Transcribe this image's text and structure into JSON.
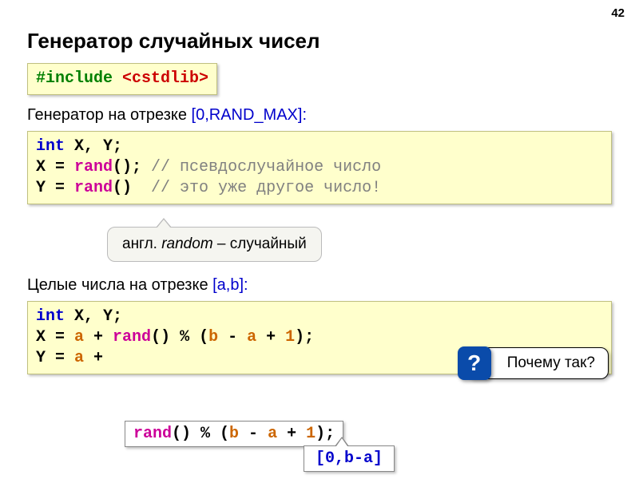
{
  "pageNumber": "42",
  "title": "Генератор случайных чисел",
  "includeLine": {
    "directive": "#include",
    "header": "<cstdlib>"
  },
  "section1": {
    "heading_pre": "Генератор на отрезке ",
    "heading_range": "[0,RAND_MAX]:",
    "code": {
      "l1a": "int",
      "l1b": " X, Y;",
      "l2a": "X = ",
      "l2b": "rand",
      "l2c": "(); ",
      "l2d": "// псевдослучайное число",
      "l3a": "Y = ",
      "l3b": "rand",
      "l3c": "()  ",
      "l3d": "// это уже другое число!"
    }
  },
  "callout": {
    "text_pre": "англ. ",
    "text_em": "random",
    "text_post": " – случайный"
  },
  "section2": {
    "heading_pre": "Целые числа на отрезке ",
    "heading_range": "[a,b]:",
    "code": {
      "l1a": "int",
      "l1b": " X, Y;",
      "l2a": "X = ",
      "l2b": "a",
      "l2c": " + ",
      "l2d": "rand",
      "l2e": "() % (",
      "l2f": "b",
      "l2g": " - ",
      "l2h": "a",
      "l2i": " + ",
      "l2j": "1",
      "l2k": ");",
      "l3a": "Y = ",
      "l3b": "a",
      "l3c": " + "
    }
  },
  "overlay1": {
    "a": "rand",
    "b": "() % (",
    "c": "b",
    "d": " - ",
    "e": "a",
    "f": " + ",
    "g": "1",
    "h": ");"
  },
  "overlay2": "[0,b-a]",
  "whyBox": {
    "badge": "?",
    "text": "Почему так?"
  }
}
